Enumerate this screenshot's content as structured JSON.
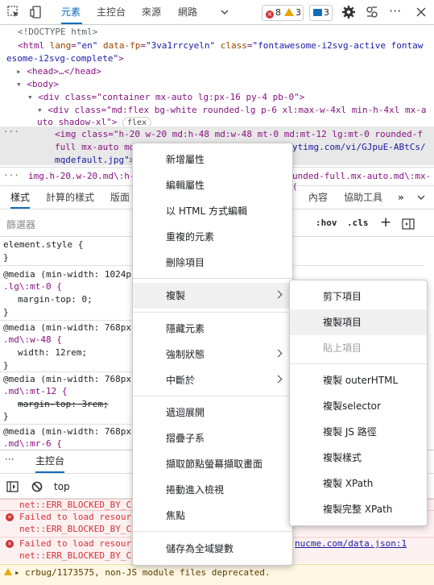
{
  "toolbar": {
    "tabs": [
      "元素",
      "主控台",
      "來源",
      "網路"
    ],
    "errors_count": "8",
    "warnings_count": "3",
    "messages_count": "3"
  },
  "dom": {
    "doctype": "<!DOCTYPE html>",
    "html_open": "<html",
    "html_lang_attr": "lang",
    "html_lang_val": "\"en\"",
    "html_fp_attr": "data-fp",
    "html_fp_val": "\"3va1rrcyeln\"",
    "html_class_attr": "class",
    "html_class_val_1": "\"fontawesome-i2svg-active fontaw",
    "html_class_val_2": "esome-i2svg-complete\"",
    "html_close": ">",
    "head": "<head>…</head>",
    "body": "<body>",
    "div1": "<div class=\"container mx-auto lg:px-16 py-4 pb-0\">",
    "div2_line1": "<div class=\"md:flex bg-white rounded-lg p-6 xl:max-w-4xl min-h-4xl mx-a",
    "div2_line2": "uto shadow-xl\">",
    "div2_badge": "flex",
    "img_line1": "<img class=\"h-20 w-20 md:h-48 md:w-48 mt-0 md:mt-12 lg:mt-0 rounded-f",
    "img_line2": "full mx-auto md",
    "img_line2_tail": "ytimg.com/vi/GJpuE-ABtCs/",
    "img_line3": "mqdefault.jpg\">"
  },
  "breadcrumb": {
    "left": "img.h-20.w-20.md\\:h-48",
    "right": "unded-full.mx-auto.md\\:mx-("
  },
  "subtabs": [
    "樣式",
    "計算的樣式",
    "版面",
    "內容",
    "協助工具"
  ],
  "filter": {
    "placeholder": "篩選器",
    "hov": ":hov",
    "cls": ".cls",
    "plus": "+"
  },
  "styles": {
    "element_style": "element.style {",
    "close": "}",
    "media1": "@media (min-width: 1024p",
    "rule1_sel": ".lg\\:mt-0 {",
    "rule1_decl": "margin-top: 0;",
    "media2": "@media (min-width: 768px",
    "rule2_sel": ".md\\:w-48 {",
    "rule2_decl": "width: 12rem;",
    "media3": "@media (min-width: 768px",
    "rule3_sel": ".md\\:mt-12 {",
    "rule3_decl": "margin-top: 3rem;",
    "media4": "@media (min-width: 768px",
    "rule4_sel": ".md\\:mr-6 {"
  },
  "console": {
    "tab": "主控台",
    "context": "top",
    "msg1_line1": "net::ERR_BLOCKED_BY_C",
    "msg2_line1": "Failed to load resour",
    "msg2_line2": "net::ERR_BLOCKED_BY_C",
    "msg3_line1": "Failed to load resour",
    "msg3_link": "nucme.com/data.json:1",
    "msg3_line2": "net::ERR_BLOCKED_BY_C",
    "warning": "crbug/1173575, non-JS module files deprecated."
  },
  "context_menu": {
    "items": [
      {
        "label": "新增屬性"
      },
      {
        "label": "編輯屬性"
      },
      {
        "label": "以 HTML 方式編輯"
      },
      {
        "label": "重複的元素"
      },
      {
        "label": "刪除項目"
      },
      {
        "label": "複製"
      },
      {
        "label": "隱藏元素"
      },
      {
        "label": "強制狀態"
      },
      {
        "label": "中斷於"
      },
      {
        "label": "遞迴展開"
      },
      {
        "label": "摺疊子系"
      },
      {
        "label": "擷取節點螢幕擷取畫面"
      },
      {
        "label": "捲動進入檢視"
      },
      {
        "label": "焦點"
      },
      {
        "label": "儲存為全域變數"
      }
    ]
  },
  "copy_submenu": {
    "items": [
      {
        "label": "剪下項目"
      },
      {
        "label": "複製項目"
      },
      {
        "label": "貼上項目"
      },
      {
        "label": "複製 outerHTML"
      },
      {
        "label": "複製selector"
      },
      {
        "label": "複製 JS 路徑"
      },
      {
        "label": "複製樣式"
      },
      {
        "label": "複製 XPath"
      },
      {
        "label": "複製完整 XPath"
      }
    ]
  }
}
